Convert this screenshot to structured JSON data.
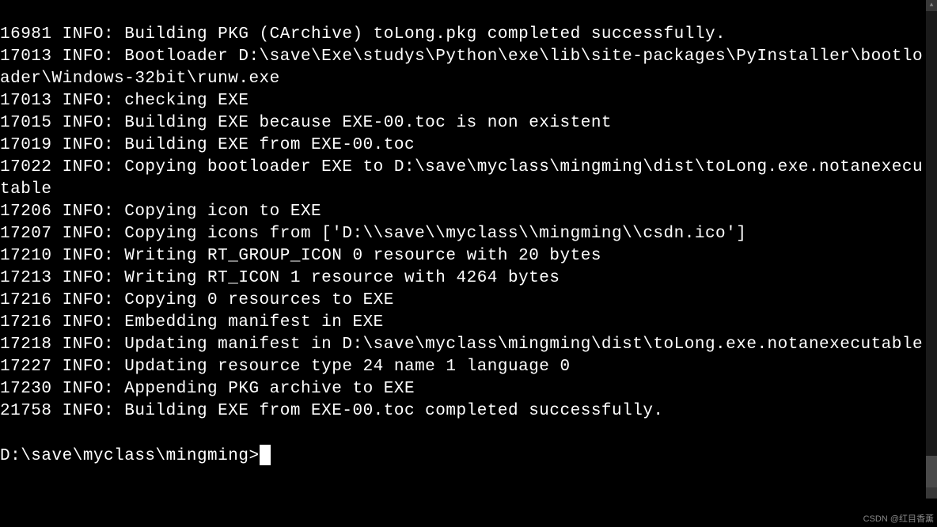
{
  "terminal": {
    "lines": [
      "16981 INFO: Building PKG (CArchive) toLong.pkg completed successfully.",
      "17013 INFO: Bootloader D:\\save\\Exe\\studys\\Python\\exe\\lib\\site-packages\\PyInstaller\\bootloader\\Windows-32bit\\runw.exe",
      "17013 INFO: checking EXE",
      "17015 INFO: Building EXE because EXE-00.toc is non existent",
      "17019 INFO: Building EXE from EXE-00.toc",
      "17022 INFO: Copying bootloader EXE to D:\\save\\myclass\\mingming\\dist\\toLong.exe.notanexecutable",
      "17206 INFO: Copying icon to EXE",
      "17207 INFO: Copying icons from ['D:\\\\save\\\\myclass\\\\mingming\\\\csdn.ico']",
      "17210 INFO: Writing RT_GROUP_ICON 0 resource with 20 bytes",
      "17213 INFO: Writing RT_ICON 1 resource with 4264 bytes",
      "17216 INFO: Copying 0 resources to EXE",
      "17216 INFO: Embedding manifest in EXE",
      "17218 INFO: Updating manifest in D:\\save\\myclass\\mingming\\dist\\toLong.exe.notanexecutable",
      "17227 INFO: Updating resource type 24 name 1 language 0",
      "17230 INFO: Appending PKG archive to EXE",
      "21758 INFO: Building EXE from EXE-00.toc completed successfully."
    ],
    "prompt": "D:\\save\\myclass\\mingming>"
  },
  "watermark": "CSDN @红目香薰"
}
